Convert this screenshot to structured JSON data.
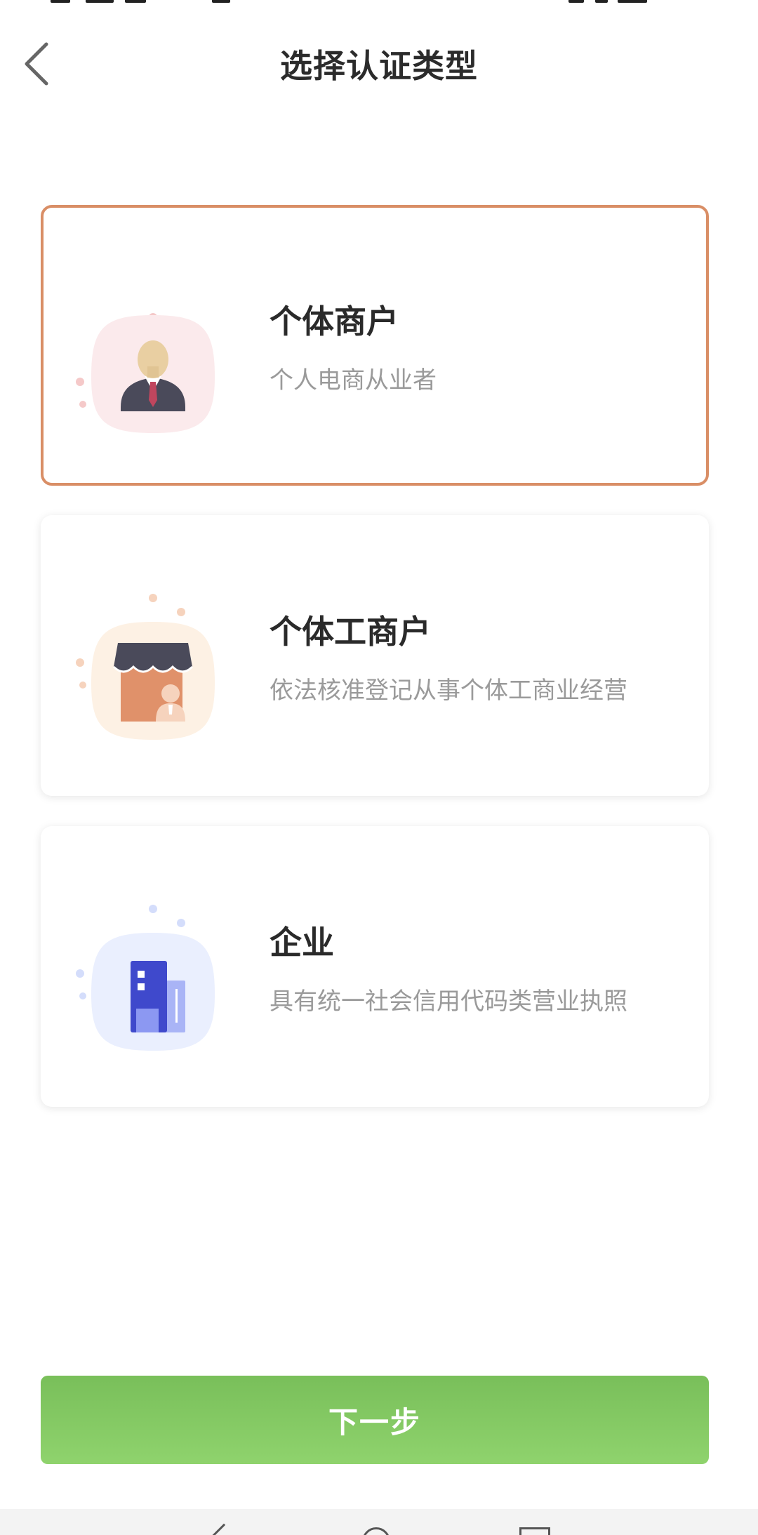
{
  "header": {
    "title": "选择认证类型",
    "back_icon": "chevron-left-icon"
  },
  "options": [
    {
      "title": "个体商户",
      "subtitle": "个人电商从业者",
      "icon": "businessman-icon",
      "selected": true,
      "accent": "#d98e66"
    },
    {
      "title": "个体工商户",
      "subtitle": "依法核准登记从事个体工商业经营",
      "icon": "storefront-icon",
      "selected": false
    },
    {
      "title": "企业",
      "subtitle": "具有统一社会信用代码类营业执照",
      "icon": "building-icon",
      "selected": false
    }
  ],
  "footer": {
    "next_label": "下一步",
    "button_color": "#7fc55f"
  },
  "colors": {
    "primary_green": "#7fc55f",
    "selected_border": "#d98e66",
    "title_text": "#2b2b2b",
    "subtitle_text": "#9a9a9a"
  }
}
